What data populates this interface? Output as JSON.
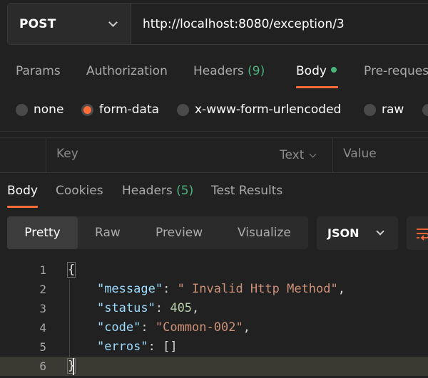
{
  "request": {
    "method": "POST",
    "url": "http://localhost:8080/exception/3"
  },
  "request_tabs": [
    {
      "label": "Params"
    },
    {
      "label": "Authorization"
    },
    {
      "label": "Headers",
      "count": "(9)"
    },
    {
      "label": "Body"
    },
    {
      "label": "Pre-reques"
    }
  ],
  "body_types": [
    {
      "label": "none"
    },
    {
      "label": "form-data"
    },
    {
      "label": "x-www-form-urlencoded"
    },
    {
      "label": "raw"
    }
  ],
  "kv_table": {
    "key_header": "Key",
    "type_label": "Text",
    "value_header": "Value"
  },
  "response_tabs": [
    {
      "label": "Body"
    },
    {
      "label": "Cookies"
    },
    {
      "label": "Headers",
      "count": "(5)"
    },
    {
      "label": "Test Results"
    }
  ],
  "view_modes": [
    {
      "label": "Pretty"
    },
    {
      "label": "Raw"
    },
    {
      "label": "Preview"
    },
    {
      "label": "Visualize"
    }
  ],
  "format_select": "JSON",
  "code": {
    "line_numbers": [
      "1",
      "2",
      "3",
      "4",
      "5",
      "6"
    ],
    "open_brace": "{",
    "close_brace": "}",
    "message_key": "\"message\"",
    "message_value": "\" Invalid Http Method\"",
    "status_key": "\"status\"",
    "status_value": "405",
    "code_key": "\"code\"",
    "code_value": "\"Common-002\"",
    "erros_key": "\"erros\"",
    "erros_value": "[]"
  },
  "colors": {
    "accent": "#ff6c37",
    "success": "#49b47a",
    "background": "#212121"
  },
  "icons": [
    "chevron-down-icon",
    "green-dot-icon",
    "wrap-lines-icon"
  ]
}
